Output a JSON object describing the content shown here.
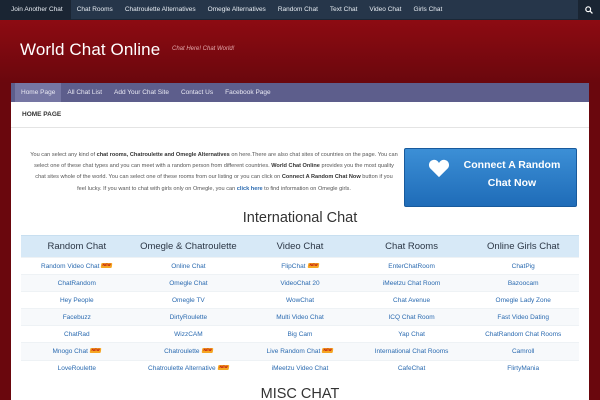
{
  "topnav": {
    "items": [
      "Join Another Chat",
      "Chat Rooms",
      "Chatroulette Alternatives",
      "Omegle Alternatives",
      "Random Chat",
      "Text Chat",
      "Video Chat",
      "Girls Chat"
    ],
    "search_icon": "search-icon"
  },
  "header": {
    "title": "World Chat Online",
    "tagline": "Chat Here! Chat World!"
  },
  "menu": {
    "items": [
      "Home Page",
      "All Chat List",
      "Add Your Chat Site",
      "Contact Us",
      "Facebook Page"
    ]
  },
  "breadcrumb": "HOME PAGE",
  "intro": {
    "p1": "You can select any kind of ",
    "b1": "chat rooms, Chatroulette and Omegle Alternatives",
    "p2": " on here.There are also chat sites of countries on the page. You can select one of these chat types and you can meet with a random person from different countries. ",
    "b2": "World Chat Online",
    "p3": " provides you the most quality chat sites whole of the world. You can select one of these rooms from our listing or you can click on ",
    "b3": "Connect A Random Chat Now",
    "p4": " button if you feel lucky. If you want to chat with girls only on Omegle, you can ",
    "link": "click here",
    "p5": " to find information on Omegle girls."
  },
  "cta": {
    "line1": "Connect A Random",
    "line2": "Chat Now",
    "icon": "heart-icon"
  },
  "international": {
    "title": "International Chat",
    "headers": [
      "Random Chat",
      "Omegle & Chatroulette",
      "Video Chat",
      "Chat Rooms",
      "Online Girls Chat"
    ],
    "new_badge": "NEW",
    "rows": [
      [
        {
          "t": "Random Video Chat",
          "n": true
        },
        {
          "t": "Online Chat"
        },
        {
          "t": "FlipChat",
          "n": true
        },
        {
          "t": "EnterChatRoom"
        },
        {
          "t": "ChatPig"
        }
      ],
      [
        {
          "t": "ChatRandom"
        },
        {
          "t": "Omegle Chat"
        },
        {
          "t": "VideoChat 20"
        },
        {
          "t": "iMeetzu Chat Room"
        },
        {
          "t": "Bazoocam"
        }
      ],
      [
        {
          "t": "Hey People"
        },
        {
          "t": "Omegle TV"
        },
        {
          "t": "WowChat"
        },
        {
          "t": "Chat Avenue"
        },
        {
          "t": "Omegle Lady Zone"
        }
      ],
      [
        {
          "t": "Facebuzz"
        },
        {
          "t": "DirtyRoulette"
        },
        {
          "t": "Multi Video Chat"
        },
        {
          "t": "ICQ Chat Room"
        },
        {
          "t": "Fast Video Dating"
        }
      ],
      [
        {
          "t": "ChatRad"
        },
        {
          "t": "WizzCAM"
        },
        {
          "t": "Big Cam"
        },
        {
          "t": "Yap Chat"
        },
        {
          "t": "ChatRandom Chat Rooms"
        }
      ],
      [
        {
          "t": "Mnogo Chat",
          "n": true
        },
        {
          "t": "Chatroulette",
          "n": true
        },
        {
          "t": "Live Random Chat",
          "n": true
        },
        {
          "t": "International Chat Rooms"
        },
        {
          "t": "Camroll"
        }
      ],
      [
        {
          "t": "LoveRoulette"
        },
        {
          "t": "Chatroulette Alternative",
          "n": true
        },
        {
          "t": "iMeetzu Video Chat"
        },
        {
          "t": "CafeChat"
        },
        {
          "t": "FlirtyMania"
        }
      ]
    ]
  },
  "misc": {
    "title": "MISC CHAT"
  },
  "colors": {
    "header_red": "#8d0b12",
    "menu_purple": "#5d5e8c",
    "topnav": "#26364a",
    "link": "#2a6ab0",
    "cta": "#2a7ccb"
  }
}
